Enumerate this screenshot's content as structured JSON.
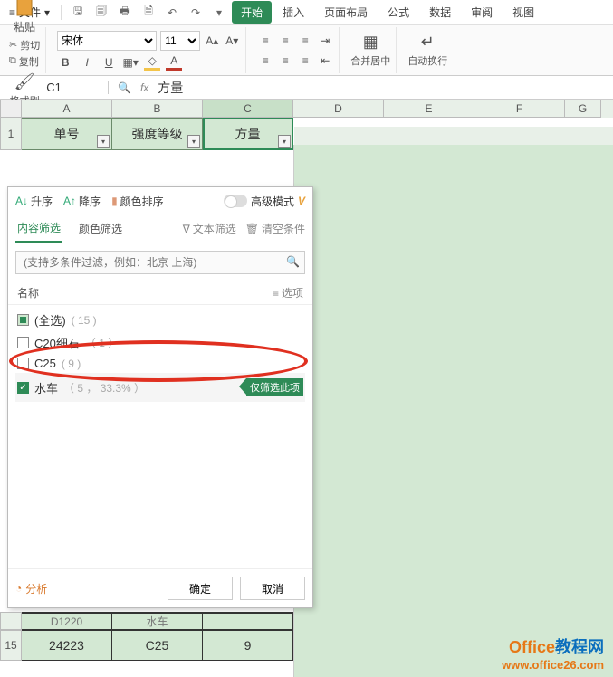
{
  "menubar": {
    "file": "文件",
    "tabs": [
      "开始",
      "插入",
      "页面布局",
      "公式",
      "数据",
      "审阅",
      "视图"
    ]
  },
  "ribbon": {
    "paste": "粘贴",
    "cut": "剪切",
    "copy": "复制",
    "format_painter": "格式刷",
    "font_name": "宋体",
    "font_size": "11",
    "merge": "合并居中",
    "wrap": "自动换行"
  },
  "formula": {
    "name_box": "C1",
    "fx": "fx",
    "value": "方量"
  },
  "columns": [
    "A",
    "B",
    "C",
    "D",
    "E",
    "F",
    "G"
  ],
  "header_row": {
    "num": "1",
    "cells": [
      "单号",
      "强度等级",
      "方量"
    ]
  },
  "filter": {
    "sort_asc": "升序",
    "sort_desc": "降序",
    "color_sort": "颜色排序",
    "adv_mode": "高级模式",
    "tab_content": "内容筛选",
    "tab_color": "颜色筛选",
    "text_filter": "文本筛选",
    "clear": "清空条件",
    "search_placeholder": "(支持多条件过滤，例如：北京 上海)",
    "list_head": "名称",
    "options": "选项",
    "items": [
      {
        "label": "(全选)",
        "count": "( 15 )",
        "state": "mixed"
      },
      {
        "label": "C20细石",
        "count": "（ 1 ）",
        "state": "unchecked"
      },
      {
        "label": "C25",
        "count": "( 9 )",
        "state": "unchecked"
      },
      {
        "label": "水车",
        "count": "（ 5 ， 33.3% ）",
        "state": "checked",
        "badge": "仅筛选此项"
      }
    ],
    "analysis": "分析",
    "ok": "确定",
    "cancel": "取消"
  },
  "bottom": {
    "partial_row": [
      "D1220",
      "水车",
      ""
    ],
    "row15_num": "15",
    "row15": [
      "24223",
      "C25",
      "9"
    ]
  },
  "watermark": {
    "line1a": "Office",
    "line1b": "教程网",
    "line2": "www.office26.com"
  }
}
